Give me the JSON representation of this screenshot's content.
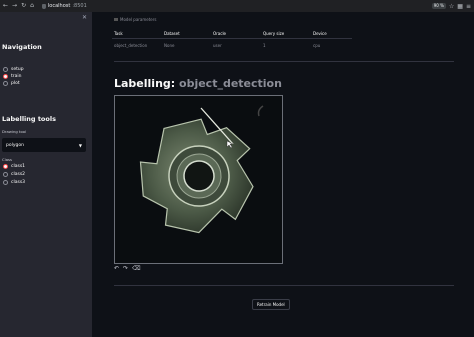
{
  "browser": {
    "host": "localhost",
    "port": ":8501",
    "zoom": "90 %"
  },
  "sidebar": {
    "navigation_heading": "Navigation",
    "navigation_items": [
      {
        "label": "setup",
        "selected": false
      },
      {
        "label": "train",
        "selected": true
      },
      {
        "label": "plot",
        "selected": false
      }
    ],
    "tools_heading": "Labelling tools",
    "drawing_tool_label": "Drawing tool",
    "drawing_tool_value": "polygon",
    "class_label": "Class",
    "class_items": [
      {
        "label": "class1",
        "selected": true
      },
      {
        "label": "class2",
        "selected": false
      },
      {
        "label": "class3",
        "selected": false
      }
    ]
  },
  "main": {
    "partial_heading": "Model parameters",
    "table": {
      "headers": [
        "Task",
        "Dataset",
        "Oracle",
        "Query size",
        "Device"
      ],
      "row": [
        "object_detection",
        "None",
        "user",
        "1",
        "cpu"
      ]
    },
    "title_prefix": "Labelling: ",
    "title_code": "object_detection",
    "retrain_label": "Retrain Model"
  },
  "colors": {
    "accent": "#ff4b4b",
    "background": "#0e1117",
    "sidebar": "#262730"
  }
}
